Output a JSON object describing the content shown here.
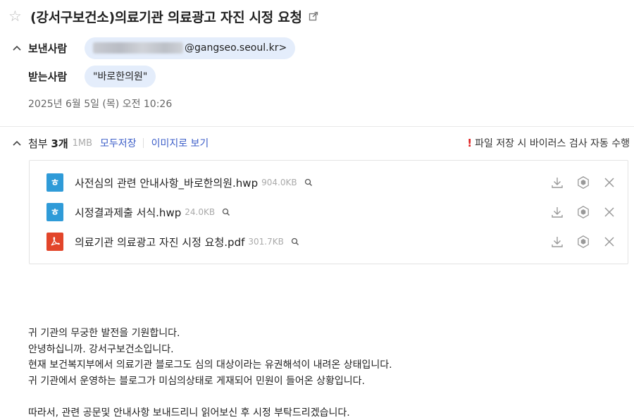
{
  "email": {
    "subject": "(강서구보건소)의료기관 의료광고 자진 시정 요청",
    "sender_label": "보낸사람",
    "sender_email_visible": "@gangseo.seoul.kr>",
    "recipient_label": "받는사람",
    "recipient_name": "\"바로한의원\"",
    "date": "2025년 6월 5일 (목) 오전 10:26"
  },
  "attachments": {
    "label": "첨부",
    "count": "3개",
    "total_size": "1MB",
    "save_all_label": "모두저장",
    "view_as_image_label": "이미지로 보기",
    "virus_notice": "파일 저장 시 바이러스 검사 자동 수행",
    "files": [
      {
        "icon": "hwp-file-icon",
        "icon_glyph": "ㅎ",
        "name": "사전심의 관련 안내사항_바로한의원.hwp",
        "size": "904.0KB"
      },
      {
        "icon": "hwp-file-icon",
        "icon_glyph": "ㅎ",
        "name": "시정결과제출 서식.hwp",
        "size": "24.0KB"
      },
      {
        "icon": "pdf-file-icon",
        "icon_glyph": "",
        "name": "의료기관 의료광고 자진 시정 요청.pdf",
        "size": "301.7KB"
      }
    ]
  },
  "body": {
    "lines": [
      "귀 기관의 무궁한 발전을 기원합니다.",
      "안녕하십니까. 강서구보건소입니다.",
      "현재 보건복지부에서 의료기관 블로그도 심의 대상이라는 유권해석이 내려온 상태입니다.",
      "귀 기관에서 운영하는 블로그가 미심의상태로 게재되어 민원이 들어온 상황입니다.",
      "",
      "따라서, 관련 공문및 안내사항 보내드리니 읽어보신 후 시정 부탁드리겠습니다."
    ]
  },
  "colors": {
    "pill_bg": "#e4edfb",
    "link": "#3c5ec8",
    "hwp_icon": "#2f9bd8",
    "pdf_icon": "#e2452a",
    "warning": "#e02020"
  }
}
